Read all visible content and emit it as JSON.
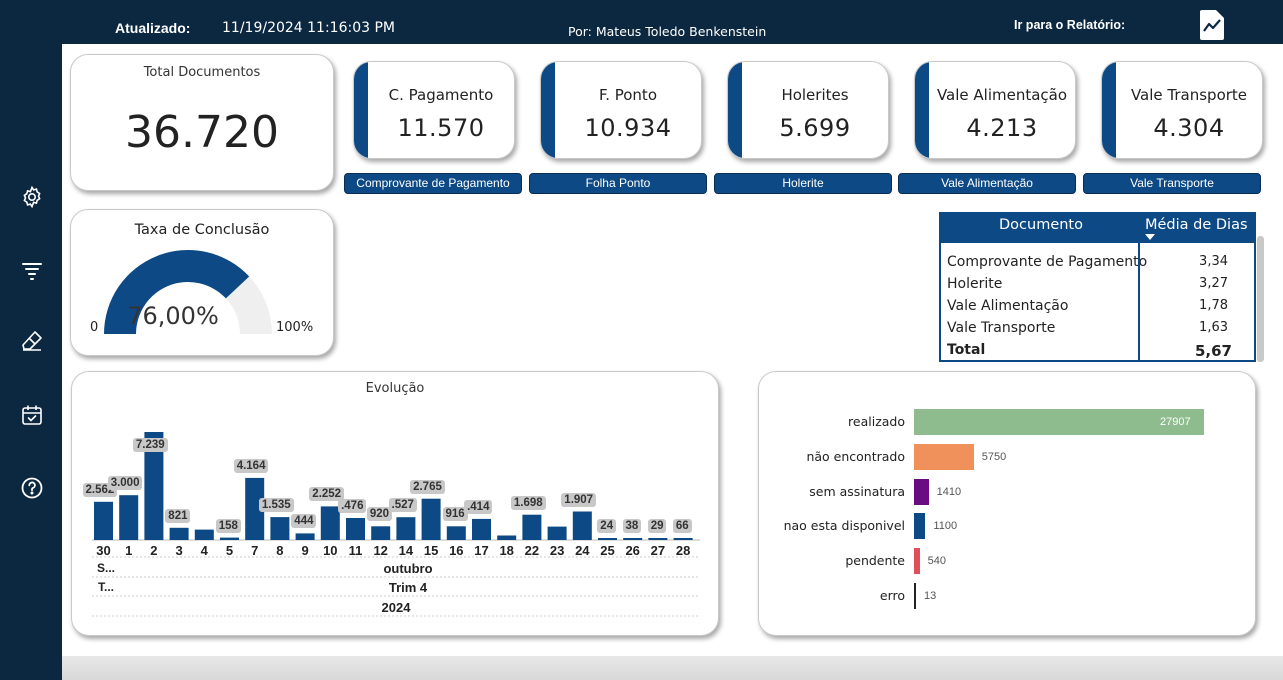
{
  "header": {
    "updated_label": "Atualizado:",
    "updated_value": "11/19/2024 11:16:03 PM",
    "by": "Por: Mateus Toledo Benkenstein",
    "report_link": "Ir para o Relatório:"
  },
  "sidebar": {
    "icons": [
      "gear-icon",
      "filter-icon",
      "eraser-icon",
      "calendar-icon",
      "help-icon"
    ]
  },
  "total": {
    "title": "Total Documentos",
    "value": "36.720"
  },
  "kpis": [
    {
      "title": "C. Pagamento",
      "value": "11.570",
      "button": "Comprovante de Pagamento"
    },
    {
      "title": "F. Ponto",
      "value": "10.934",
      "button": "Folha Ponto"
    },
    {
      "title": "Holerites",
      "value": "5.699",
      "button": "Holerite"
    },
    {
      "title": "Vale Alimentação",
      "value": "4.213",
      "button": "Vale Alimentação"
    },
    {
      "title": "Vale Transporte",
      "value": "4.304",
      "button": "Vale Transporte"
    }
  ],
  "gauge": {
    "title": "Taxa de Conclusão",
    "value": "76,00%",
    "min": "0",
    "max": "100%",
    "fraction": 0.76
  },
  "table": {
    "col1": "Documento",
    "col2": "Média de Dias",
    "rows": [
      {
        "name": "Comprovante de Pagamento",
        "days": "3,34"
      },
      {
        "name": "Holerite",
        "days": "3,27"
      },
      {
        "name": "Vale Alimentação",
        "days": "1,78"
      },
      {
        "name": "Vale Transporte",
        "days": "1,63"
      }
    ],
    "total_label": "Total",
    "total_value": "5,67"
  },
  "colors": {
    "navy": "#0c2841",
    "blue": "#0d4a85",
    "realizado": "#8fbc8f",
    "nao_encontrado": "#f0905a",
    "sem_assinatura": "#6a0d83",
    "nao_disponivel": "#0d4a85",
    "pendente": "#e0505a",
    "erro": "#222222"
  },
  "chart_data": [
    {
      "type": "bar",
      "title": "Evolução",
      "categories": [
        "30",
        "1",
        "2",
        "3",
        "4",
        "5",
        "7",
        "8",
        "9",
        "10",
        "11",
        "12",
        "14",
        "15",
        "16",
        "17",
        "18",
        "22",
        "23",
        "24",
        "25",
        "26",
        "27",
        "28"
      ],
      "values": [
        2562,
        3000,
        7239,
        821,
        700,
        158,
        4164,
        1535,
        444,
        2252,
        1476,
        920,
        1527,
        2765,
        916,
        1414,
        300,
        1698,
        900,
        1907,
        24,
        38,
        29,
        66
      ],
      "labels": [
        "2.562",
        "3.000",
        "7.239",
        "821",
        "",
        "158",
        "4.164",
        "1.535",
        "444",
        "2.252",
        ".476",
        "920",
        ".527",
        "2.765",
        "916",
        ".414",
        "",
        "1.698",
        "",
        "1.907",
        "24",
        "38",
        "29",
        "66"
      ],
      "month_labels": [
        "S...",
        "outubro"
      ],
      "quarter_labels": [
        "T...",
        "Trim 4"
      ],
      "year_label": "2024"
    },
    {
      "type": "bar",
      "orientation": "horizontal",
      "categories": [
        "realizado",
        "não encontrado",
        "sem assinatura",
        "nao esta disponivel",
        "pendente",
        "erro"
      ],
      "values": [
        27907,
        5750,
        1410,
        1100,
        540,
        13
      ]
    }
  ]
}
